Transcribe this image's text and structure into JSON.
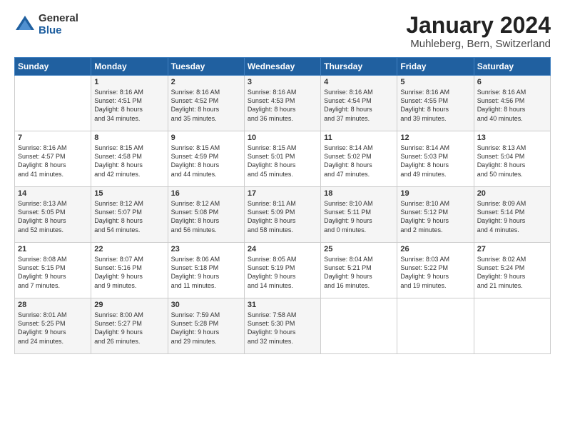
{
  "logo": {
    "general": "General",
    "blue": "Blue"
  },
  "title": "January 2024",
  "subtitle": "Muhleberg, Bern, Switzerland",
  "days_header": [
    "Sunday",
    "Monday",
    "Tuesday",
    "Wednesday",
    "Thursday",
    "Friday",
    "Saturday"
  ],
  "weeks": [
    [
      {
        "day": "",
        "info": ""
      },
      {
        "day": "1",
        "info": "Sunrise: 8:16 AM\nSunset: 4:51 PM\nDaylight: 8 hours\nand 34 minutes."
      },
      {
        "day": "2",
        "info": "Sunrise: 8:16 AM\nSunset: 4:52 PM\nDaylight: 8 hours\nand 35 minutes."
      },
      {
        "day": "3",
        "info": "Sunrise: 8:16 AM\nSunset: 4:53 PM\nDaylight: 8 hours\nand 36 minutes."
      },
      {
        "day": "4",
        "info": "Sunrise: 8:16 AM\nSunset: 4:54 PM\nDaylight: 8 hours\nand 37 minutes."
      },
      {
        "day": "5",
        "info": "Sunrise: 8:16 AM\nSunset: 4:55 PM\nDaylight: 8 hours\nand 39 minutes."
      },
      {
        "day": "6",
        "info": "Sunrise: 8:16 AM\nSunset: 4:56 PM\nDaylight: 8 hours\nand 40 minutes."
      }
    ],
    [
      {
        "day": "7",
        "info": "Sunrise: 8:16 AM\nSunset: 4:57 PM\nDaylight: 8 hours\nand 41 minutes."
      },
      {
        "day": "8",
        "info": "Sunrise: 8:15 AM\nSunset: 4:58 PM\nDaylight: 8 hours\nand 42 minutes."
      },
      {
        "day": "9",
        "info": "Sunrise: 8:15 AM\nSunset: 4:59 PM\nDaylight: 8 hours\nand 44 minutes."
      },
      {
        "day": "10",
        "info": "Sunrise: 8:15 AM\nSunset: 5:01 PM\nDaylight: 8 hours\nand 45 minutes."
      },
      {
        "day": "11",
        "info": "Sunrise: 8:14 AM\nSunset: 5:02 PM\nDaylight: 8 hours\nand 47 minutes."
      },
      {
        "day": "12",
        "info": "Sunrise: 8:14 AM\nSunset: 5:03 PM\nDaylight: 8 hours\nand 49 minutes."
      },
      {
        "day": "13",
        "info": "Sunrise: 8:13 AM\nSunset: 5:04 PM\nDaylight: 8 hours\nand 50 minutes."
      }
    ],
    [
      {
        "day": "14",
        "info": "Sunrise: 8:13 AM\nSunset: 5:05 PM\nDaylight: 8 hours\nand 52 minutes."
      },
      {
        "day": "15",
        "info": "Sunrise: 8:12 AM\nSunset: 5:07 PM\nDaylight: 8 hours\nand 54 minutes."
      },
      {
        "day": "16",
        "info": "Sunrise: 8:12 AM\nSunset: 5:08 PM\nDaylight: 8 hours\nand 56 minutes."
      },
      {
        "day": "17",
        "info": "Sunrise: 8:11 AM\nSunset: 5:09 PM\nDaylight: 8 hours\nand 58 minutes."
      },
      {
        "day": "18",
        "info": "Sunrise: 8:10 AM\nSunset: 5:11 PM\nDaylight: 9 hours\nand 0 minutes."
      },
      {
        "day": "19",
        "info": "Sunrise: 8:10 AM\nSunset: 5:12 PM\nDaylight: 9 hours\nand 2 minutes."
      },
      {
        "day": "20",
        "info": "Sunrise: 8:09 AM\nSunset: 5:14 PM\nDaylight: 9 hours\nand 4 minutes."
      }
    ],
    [
      {
        "day": "21",
        "info": "Sunrise: 8:08 AM\nSunset: 5:15 PM\nDaylight: 9 hours\nand 7 minutes."
      },
      {
        "day": "22",
        "info": "Sunrise: 8:07 AM\nSunset: 5:16 PM\nDaylight: 9 hours\nand 9 minutes."
      },
      {
        "day": "23",
        "info": "Sunrise: 8:06 AM\nSunset: 5:18 PM\nDaylight: 9 hours\nand 11 minutes."
      },
      {
        "day": "24",
        "info": "Sunrise: 8:05 AM\nSunset: 5:19 PM\nDaylight: 9 hours\nand 14 minutes."
      },
      {
        "day": "25",
        "info": "Sunrise: 8:04 AM\nSunset: 5:21 PM\nDaylight: 9 hours\nand 16 minutes."
      },
      {
        "day": "26",
        "info": "Sunrise: 8:03 AM\nSunset: 5:22 PM\nDaylight: 9 hours\nand 19 minutes."
      },
      {
        "day": "27",
        "info": "Sunrise: 8:02 AM\nSunset: 5:24 PM\nDaylight: 9 hours\nand 21 minutes."
      }
    ],
    [
      {
        "day": "28",
        "info": "Sunrise: 8:01 AM\nSunset: 5:25 PM\nDaylight: 9 hours\nand 24 minutes."
      },
      {
        "day": "29",
        "info": "Sunrise: 8:00 AM\nSunset: 5:27 PM\nDaylight: 9 hours\nand 26 minutes."
      },
      {
        "day": "30",
        "info": "Sunrise: 7:59 AM\nSunset: 5:28 PM\nDaylight: 9 hours\nand 29 minutes."
      },
      {
        "day": "31",
        "info": "Sunrise: 7:58 AM\nSunset: 5:30 PM\nDaylight: 9 hours\nand 32 minutes."
      },
      {
        "day": "",
        "info": ""
      },
      {
        "day": "",
        "info": ""
      },
      {
        "day": "",
        "info": ""
      }
    ]
  ]
}
